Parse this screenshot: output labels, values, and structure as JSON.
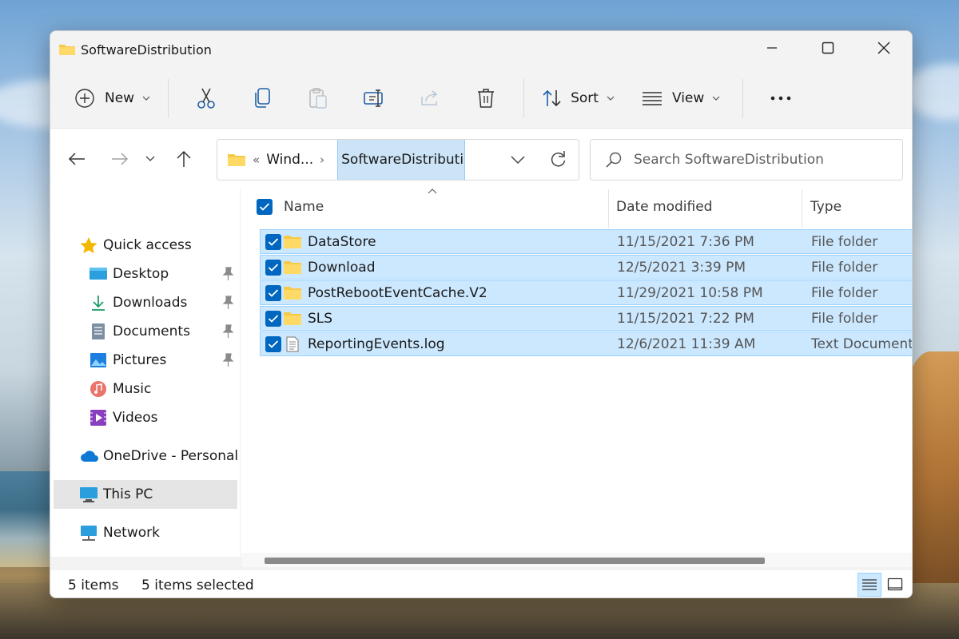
{
  "window": {
    "title": "SoftwareDistribution"
  },
  "toolbar": {
    "new_label": "New",
    "sort_label": "Sort",
    "view_label": "View"
  },
  "address": {
    "parent_crumb": "Wind...",
    "current_crumb": "SoftwareDistributi..."
  },
  "search": {
    "placeholder": "Search SoftwareDistribution"
  },
  "sidebar": {
    "items": [
      {
        "label": "Quick access"
      },
      {
        "label": "Desktop"
      },
      {
        "label": "Downloads"
      },
      {
        "label": "Documents"
      },
      {
        "label": "Pictures"
      },
      {
        "label": "Music"
      },
      {
        "label": "Videos"
      },
      {
        "label": "OneDrive - Personal"
      },
      {
        "label": "This PC"
      },
      {
        "label": "Network"
      }
    ]
  },
  "columns": {
    "name": "Name",
    "date": "Date modified",
    "type": "Type"
  },
  "files": [
    {
      "name": "DataStore",
      "date": "11/15/2021 7:36 PM",
      "type": "File folder"
    },
    {
      "name": "Download",
      "date": "12/5/2021 3:39 PM",
      "type": "File folder"
    },
    {
      "name": "PostRebootEventCache.V2",
      "date": "11/29/2021 10:58 PM",
      "type": "File folder"
    },
    {
      "name": "SLS",
      "date": "11/15/2021 7:22 PM",
      "type": "File folder"
    },
    {
      "name": "ReportingEvents.log",
      "date": "12/6/2021 11:39 AM",
      "type": "Text Document"
    }
  ],
  "status": {
    "count": "5 items",
    "selected": "5 items selected"
  },
  "colors": {
    "accent": "#0067c0",
    "selection": "#cce8ff",
    "folder": "#f7c948"
  }
}
